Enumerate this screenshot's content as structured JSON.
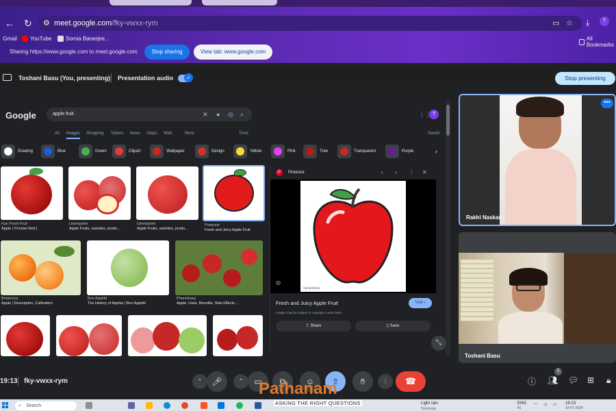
{
  "browser": {
    "url_main": "meet.google.com",
    "url_rest": "/fky-vwxx-rym",
    "bookmarks": [
      "Gmail",
      "YouTube",
      "Somia Banerjee...",
      "All Bookmarks"
    ],
    "share_notice": "Sharing https://www.google.com to meet.google.com",
    "stop_sharing": "Stop sharing",
    "view_tab": "View tab: www.google.com"
  },
  "meet": {
    "presenter": "Toshani Basu (You, presenting)",
    "presentation_audio": "Presentation audio",
    "stop_presenting": "Stop presenting",
    "meeting_time": "19:13",
    "meeting_code": "fky-vwxx-rym",
    "people_count": "3",
    "participants": [
      {
        "name": "Rakhi Naskar"
      },
      {
        "name": "Toshani Basu"
      }
    ]
  },
  "google": {
    "logo": "Google",
    "query": "apple fruit",
    "avatar_initial": "T",
    "tabs": [
      "All",
      "Images",
      "Shopping",
      "Videos",
      "News",
      "Maps",
      "Web",
      "More"
    ],
    "tools": "Tools",
    "saved": "Saved",
    "chips": [
      {
        "label": "Drawing",
        "color": "#ffffff"
      },
      {
        "label": "Blue",
        "color": "#1e5bd6"
      },
      {
        "label": "Green",
        "color": "#4caf50"
      },
      {
        "label": "Clipart",
        "color": "#e53935"
      },
      {
        "label": "Wallpaper",
        "color": "#c62828"
      },
      {
        "label": "Design",
        "color": "#d32f2f"
      },
      {
        "label": "Yellow",
        "color": "#fdd835"
      },
      {
        "label": "Pink",
        "color": "#e040fb"
      },
      {
        "label": "Tree",
        "color": "#b71c1c"
      },
      {
        "label": "Transparent",
        "color": "#c62828"
      },
      {
        "label": "Purple",
        "color": "#6a1b9a"
      }
    ],
    "results": [
      {
        "source": "Kan Fresh Fruit",
        "title": "Apple ( Persian Red )"
      },
      {
        "source": "Libertyprim",
        "title": "Apple Fruits, varieties, produ..."
      },
      {
        "source": "Libertyprim",
        "title": "Apple Fruits, varieties, produ..."
      },
      {
        "source": "Pinterest",
        "title": "Fresh and Juicy Apple Fruit"
      },
      {
        "source": "Britannica",
        "title": "Apple | Description, Cultivation"
      },
      {
        "source": "Bon Appétit",
        "title": "The History of Apples | Bon Appétit"
      },
      {
        "source": "PharmEasy",
        "title": "Apple: Uses, Benefits, Side Effects ..."
      }
    ],
    "preview": {
      "source": "Pinterest",
      "watermark": "VectorStock",
      "title": "Fresh and Juicy Apple Fruit",
      "subtitle": "Images may be subject to copyright. Learn More",
      "visit": "Visit",
      "share": "Share",
      "save": "Save"
    }
  },
  "taskbar": {
    "search": "Search",
    "weather": "Light rain",
    "weather_sub": "Tomorrow",
    "lang": "ENG",
    "lang_sub": "IN",
    "time": "19:13",
    "date": "19-07-2024"
  },
  "watermark": {
    "title": "Pathanam",
    "subtitle": "ASKING THE RIGHT QUESTIONS"
  },
  "colors": {
    "meet_accent": "#8ab4f8",
    "end_call": "#ea4335",
    "chrome_purple": "#5a2ab0"
  }
}
